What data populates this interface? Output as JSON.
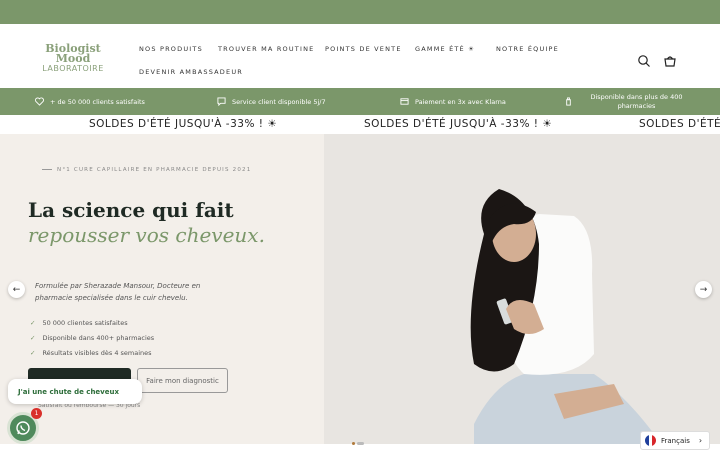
{
  "brand": {
    "line1": "Biologist",
    "line2": "Mood",
    "line3": "LABORATOIRE"
  },
  "nav": {
    "items": [
      "NOS PRODUITS",
      "TROUVER MA ROUTINE",
      "POINTS DE VENTE",
      "GAMME ÉTÉ ☀",
      "NOTRE ÉQUIPE",
      "DEVENIR AMBASSADEUR"
    ]
  },
  "header_icons": {
    "search": "search-icon",
    "cart": "cart-icon"
  },
  "benefits": [
    {
      "icon": "heart-icon",
      "text": "+ de 50 000 clients satisfaits"
    },
    {
      "icon": "chat-icon",
      "text": "Service client disponible 5j/7"
    },
    {
      "icon": "card-icon",
      "text": "Paiement en 3x avec Klarna"
    },
    {
      "icon": "bottle-icon",
      "text": "Disponible dans plus de 400 pharmacies"
    }
  ],
  "marquee": {
    "text": "SOLDES D'ÉTÉ JUSQU'À -33% ! ☀"
  },
  "hero": {
    "eyebrow": "N°1 CURE CAPILLAIRE EN PHARMACIE DEPUIS 2021",
    "headline_plain": "La science qui fait ",
    "headline_accent": "repousser vos cheveux.",
    "description": "Formulée par Sherazade Mansour, Docteure en pharmacie specialisée dans le cuir chevelu.",
    "checks": [
      "50 000 clientes satisfaites",
      "Disponible dans 400+ pharmacies",
      "Résultats visibles dès 4 semaines"
    ],
    "secondary_button": "Faire mon diagnostic",
    "guarantee": "Satisfait ou remboursé — 30 jours"
  },
  "chat": {
    "bubble": "J'ai une chute de cheveux",
    "badge": "1"
  },
  "language": {
    "label": "Français"
  },
  "colors": {
    "brand_green": "#7b976a",
    "dark": "#1f2a24",
    "cream": "#f3efea"
  }
}
